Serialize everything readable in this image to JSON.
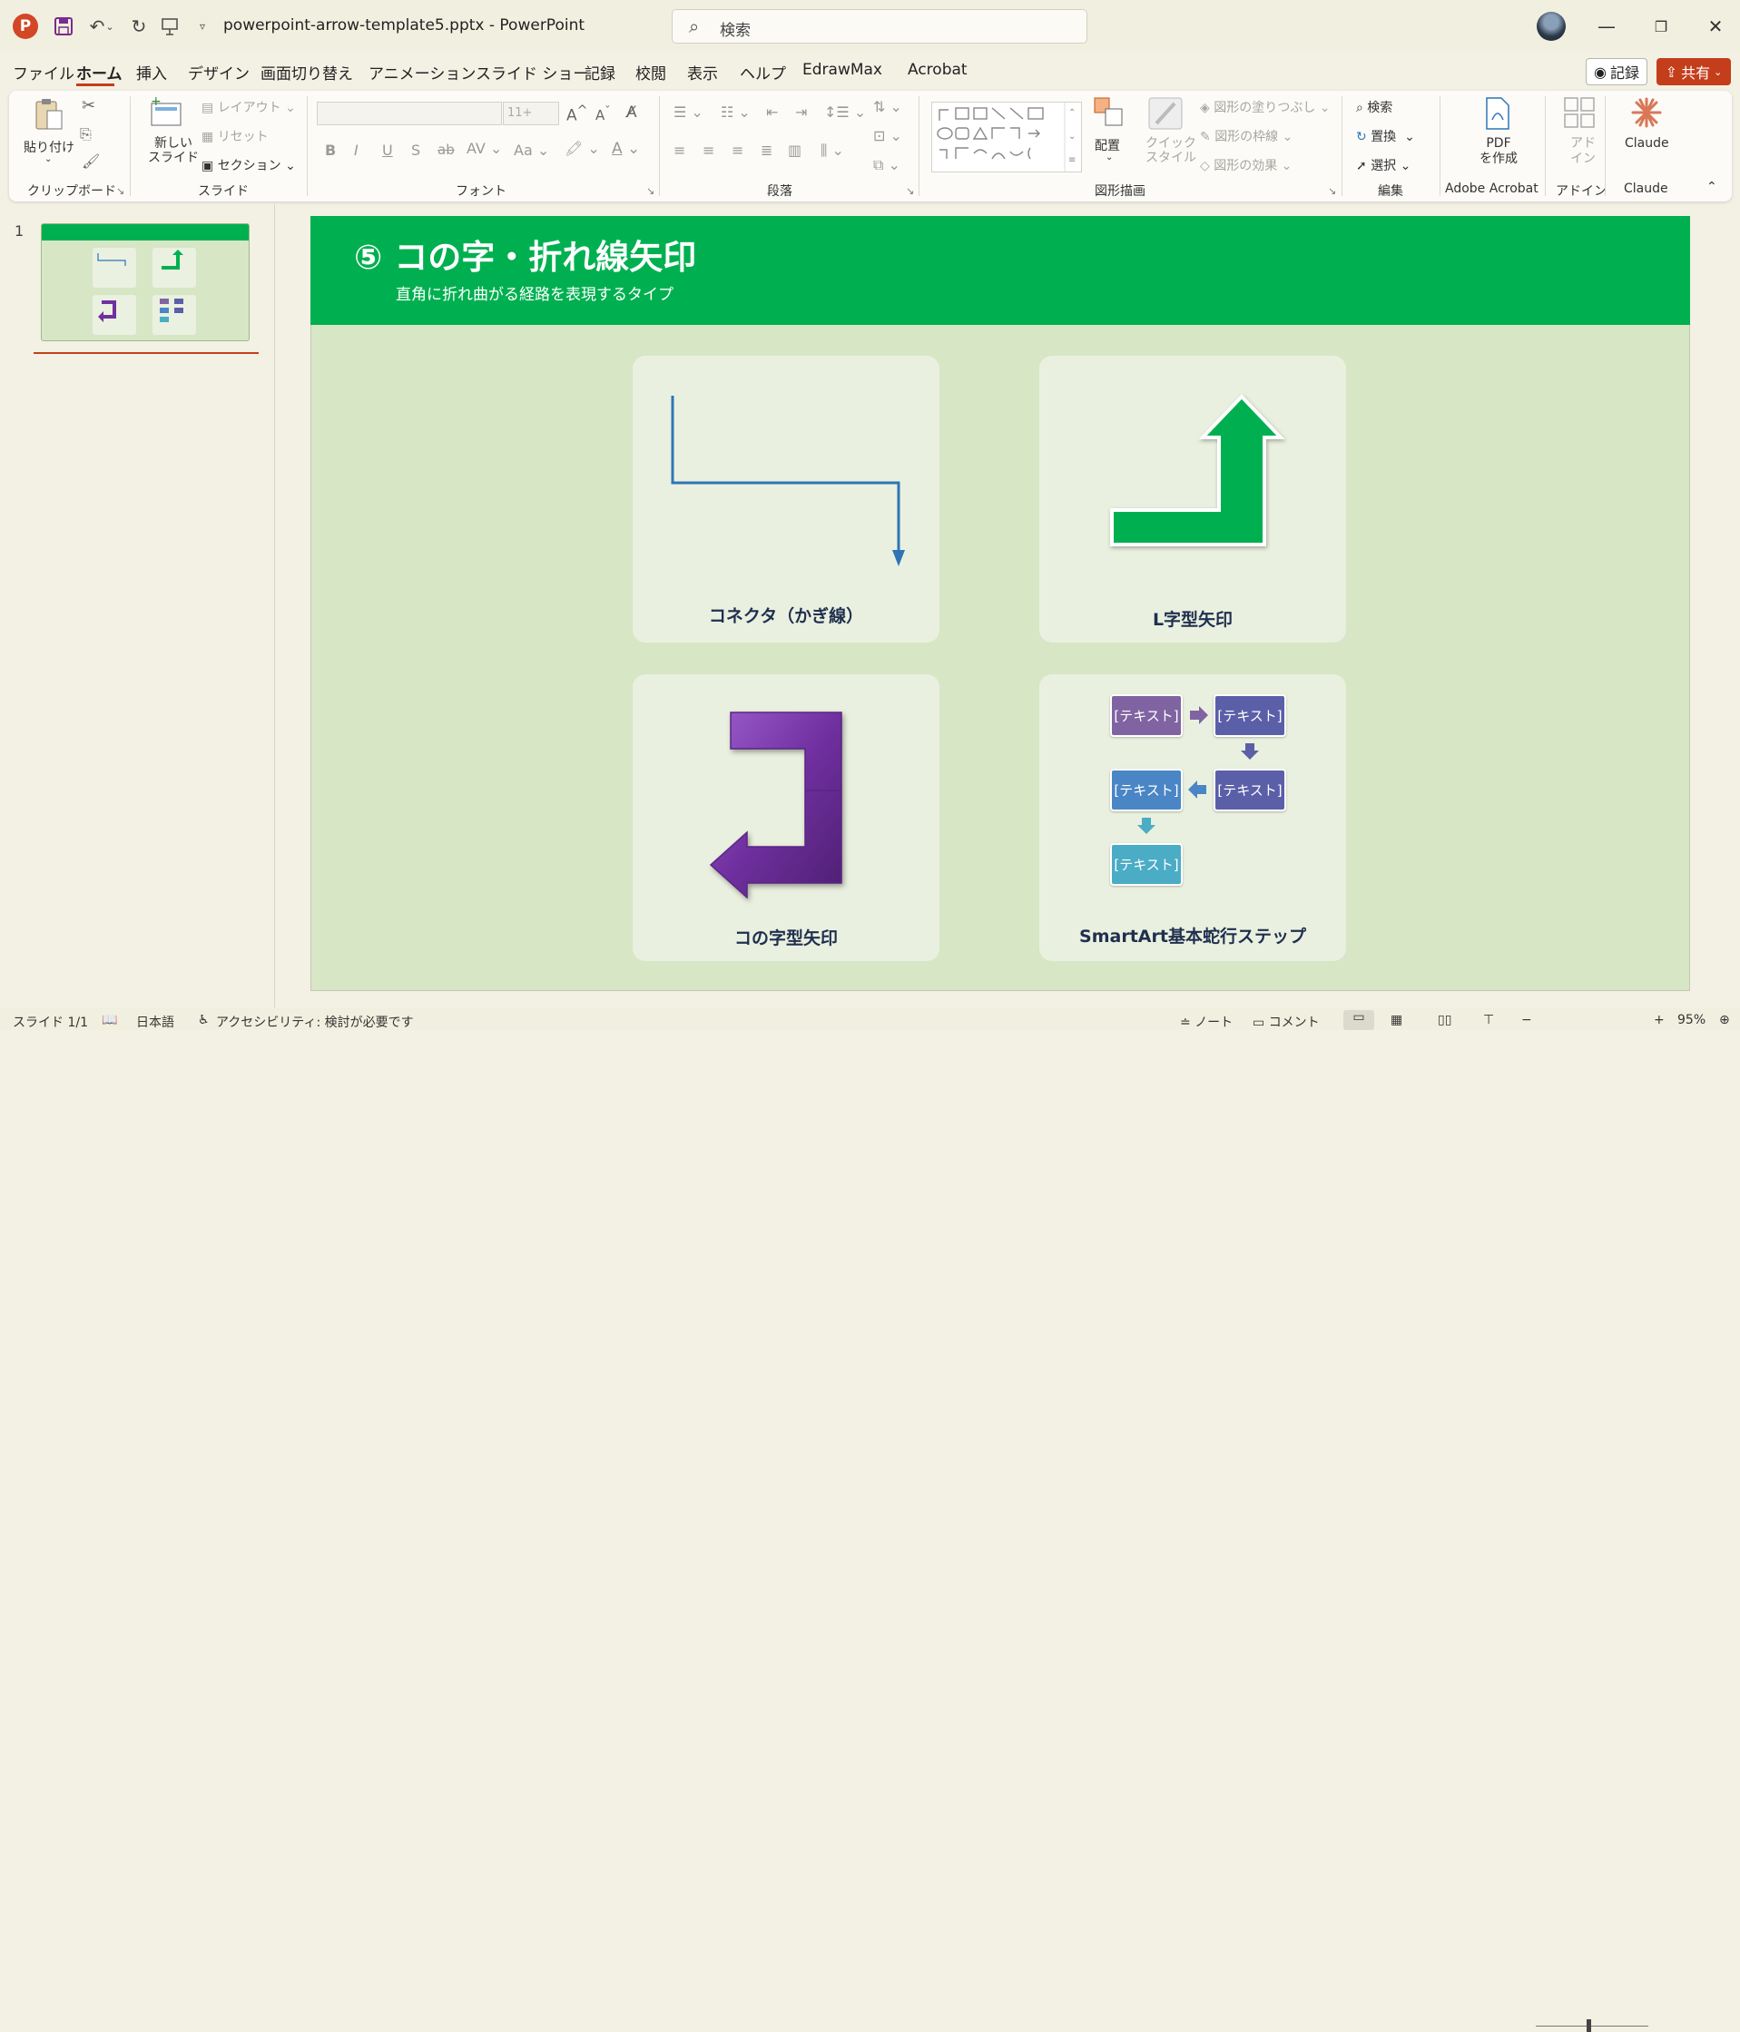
{
  "titlebar": {
    "file_title": "powerpoint-arrow-template5.pptx  -  PowerPoint",
    "search_placeholder": "検索",
    "app_letter": "P"
  },
  "menu": {
    "tabs": [
      "ファイル",
      "ホーム",
      "挿入",
      "デザイン",
      "画面切り替え",
      "アニメーション",
      "スライド ショー",
      "記録",
      "校閲",
      "表示",
      "ヘルプ",
      "EdrawMax",
      "Acrobat"
    ],
    "active": "ホーム",
    "record_label": "記録",
    "share_label": "共有"
  },
  "ribbon": {
    "clipboard": {
      "paste": "貼り付け",
      "group": "クリップボード"
    },
    "slides": {
      "new_slide": "新しい\nスライド",
      "layout": "レイアウト",
      "reset": "リセット",
      "section": "セクション",
      "group": "スライド"
    },
    "font": {
      "size": "11+",
      "group": "フォント"
    },
    "paragraph": {
      "group": "段落"
    },
    "drawing": {
      "arrange": "配置",
      "quick_style": "クイック\nスタイル",
      "fill": "図形の塗りつぶし",
      "outline": "図形の枠線",
      "effect": "図形の効果",
      "group": "図形描画"
    },
    "editing": {
      "find": "検索",
      "replace": "置換",
      "select": "選択",
      "group": "編集"
    },
    "acrobat": {
      "pdf": "PDF\nを作成",
      "group": "Adobe Acrobat"
    },
    "addin": {
      "label": "アド\nイン",
      "group": "アドイン"
    },
    "claude": {
      "label": "Claude",
      "group": "Claude"
    }
  },
  "thumbnails": {
    "slide_number": "1"
  },
  "slide": {
    "title": "⑤ コの字・折れ線矢印",
    "subtitle": "直角に折れ曲がる経路を表現するタイプ",
    "cards": [
      {
        "label": "コネクタ（かぎ線）"
      },
      {
        "label": "L字型矢印"
      },
      {
        "label": "コの字型矢印"
      },
      {
        "label": "SmartArt基本蛇行ステップ"
      }
    ],
    "smartart_boxes": [
      "[テキスト]",
      "[テキスト]",
      "[テキスト]",
      "[テキスト]",
      "[テキスト]"
    ]
  },
  "colors": {
    "header_green": "#00b050",
    "slide_bg": "#d7e6c5",
    "card_bg": "#eaf0df",
    "connector_blue": "#2e75b6",
    "l_arrow_green": "#00b050",
    "u_arrow_purple": "#7030a0",
    "accent_red": "#c43e1c"
  },
  "statusbar": {
    "slide_info": "スライド 1/1",
    "language": "日本語",
    "accessibility": "アクセシビリティ: 検討が必要です",
    "notes": "ノート",
    "comments": "コメント",
    "zoom": "95%"
  }
}
